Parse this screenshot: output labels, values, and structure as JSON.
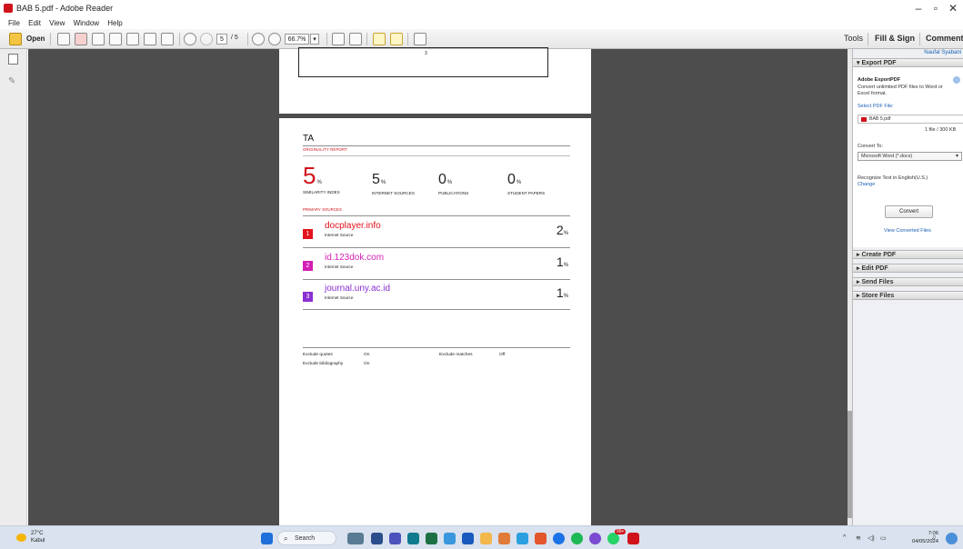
{
  "window": {
    "title": "BAB 5.pdf - Adobe Reader",
    "minimize": "–",
    "restore": "▫",
    "close": "✕"
  },
  "menu": [
    "File",
    "Edit",
    "View",
    "Window",
    "Help"
  ],
  "toolbar": {
    "open_label": "Open",
    "page_current": "5",
    "page_total": "/ 5",
    "zoom": "66.7%",
    "tools": "Tools",
    "fill_sign": "Fill & Sign",
    "comment": "Comment"
  },
  "report": {
    "title": "TA",
    "originality": "ORIGINALITY REPORT",
    "stats": [
      {
        "value": "5",
        "unit": "%",
        "label": "SIMILARITY INDEX"
      },
      {
        "value": "5",
        "unit": "%",
        "label": "INTERNET SOURCES"
      },
      {
        "value": "0",
        "unit": "%",
        "label": "PUBLICATIONS"
      },
      {
        "value": "0",
        "unit": "%",
        "label": "STUDENT PAPERS"
      }
    ],
    "primary": "PRIMARY SOURCES",
    "sources": [
      {
        "rank": "1",
        "name": "docplayer.info",
        "type": "Internet Source",
        "pct": "2",
        "unit": "%",
        "color": "#e3121c"
      },
      {
        "rank": "2",
        "name": "id.123dok.com",
        "type": "Internet Source",
        "pct": "1",
        "unit": "%",
        "color": "#d41fb4"
      },
      {
        "rank": "3",
        "name": "journal.uny.ac.id",
        "type": "Internet Source",
        "pct": "1",
        "unit": "%",
        "color": "#8a2fd0"
      }
    ],
    "exclude_quotes_label": "Exclude quotes",
    "exclude_quotes_value": "On",
    "exclude_bib_label": "Exclude bibliography",
    "exclude_bib_value": "On",
    "exclude_matches_label": "Exclude matches",
    "exclude_matches_value": "Off",
    "page_number": "3"
  },
  "panel": {
    "user": "Naufal Syabani",
    "export_pdf": "▾ Export PDF",
    "adobe_export": "Adobe ExportPDF",
    "export_desc1": "Convert unlimited PDF files to Word or",
    "export_desc2": "Excel format.",
    "select_file": "Select PDF File:",
    "file_name": "BAB 5.pdf",
    "file_info": "1 file / 300 KB",
    "convert_to": "Convert To:",
    "format": "Microsoft Word (*.docx)",
    "recognize": "Recognize Text in English(U.S.)",
    "change": "Change",
    "convert_btn": "Convert",
    "view_converted": "View Converted Files",
    "sections": [
      "▸ Create PDF",
      "▸ Edit PDF",
      "▸ Send Files",
      "▸ Store Files"
    ]
  },
  "taskbar": {
    "temp": "27°C",
    "location": "Kabul",
    "search": "Search",
    "time": "7:06",
    "date": "04/05/2024",
    "notif": "99+"
  }
}
